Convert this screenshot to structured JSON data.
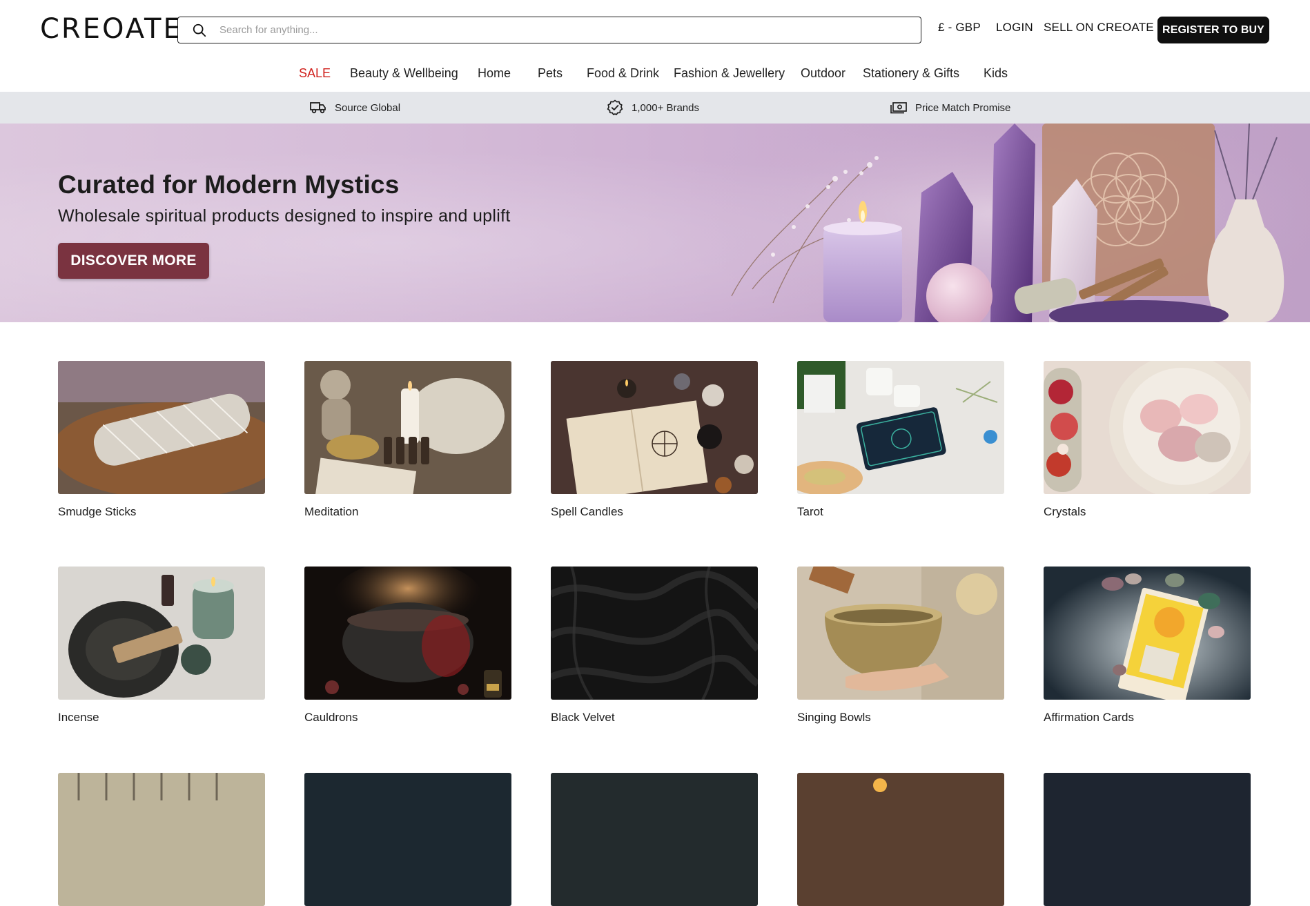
{
  "header": {
    "logo": "CREOATE",
    "search_placeholder": "Search for anything...",
    "currency": "£ - GBP",
    "login": "LOGIN",
    "sell": "SELL ON CREOATE",
    "register": "REGISTER TO BUY"
  },
  "nav": {
    "items": [
      {
        "label": "SALE",
        "color": "#d0201c"
      },
      {
        "label": "Beauty & Wellbeing"
      },
      {
        "label": "Home"
      },
      {
        "label": "Pets"
      },
      {
        "label": "Food & Drink"
      },
      {
        "label": "Fashion & Jewellery"
      },
      {
        "label": "Outdoor"
      },
      {
        "label": "Stationery & Gifts"
      },
      {
        "label": "Kids"
      }
    ]
  },
  "usp": {
    "items": [
      {
        "label": "Source Global",
        "icon": "truck-icon"
      },
      {
        "label": "1,000+ Brands",
        "icon": "verified-badge-icon"
      },
      {
        "label": "Price Match Promise",
        "icon": "cash-icon"
      }
    ]
  },
  "hero": {
    "title": "Curated for Modern Mystics",
    "subtitle": "Wholesale spiritual products designed to inspire and uplift",
    "cta": "DISCOVER MORE",
    "cta_color": "#7a3340"
  },
  "categories": [
    {
      "label": "Smudge Sticks"
    },
    {
      "label": "Meditation"
    },
    {
      "label": "Spell Candles"
    },
    {
      "label": "Tarot"
    },
    {
      "label": "Crystals"
    },
    {
      "label": "Incense"
    },
    {
      "label": "Cauldrons"
    },
    {
      "label": "Black Velvet"
    },
    {
      "label": "Singing Bowls"
    },
    {
      "label": "Affirmation Cards"
    }
  ]
}
